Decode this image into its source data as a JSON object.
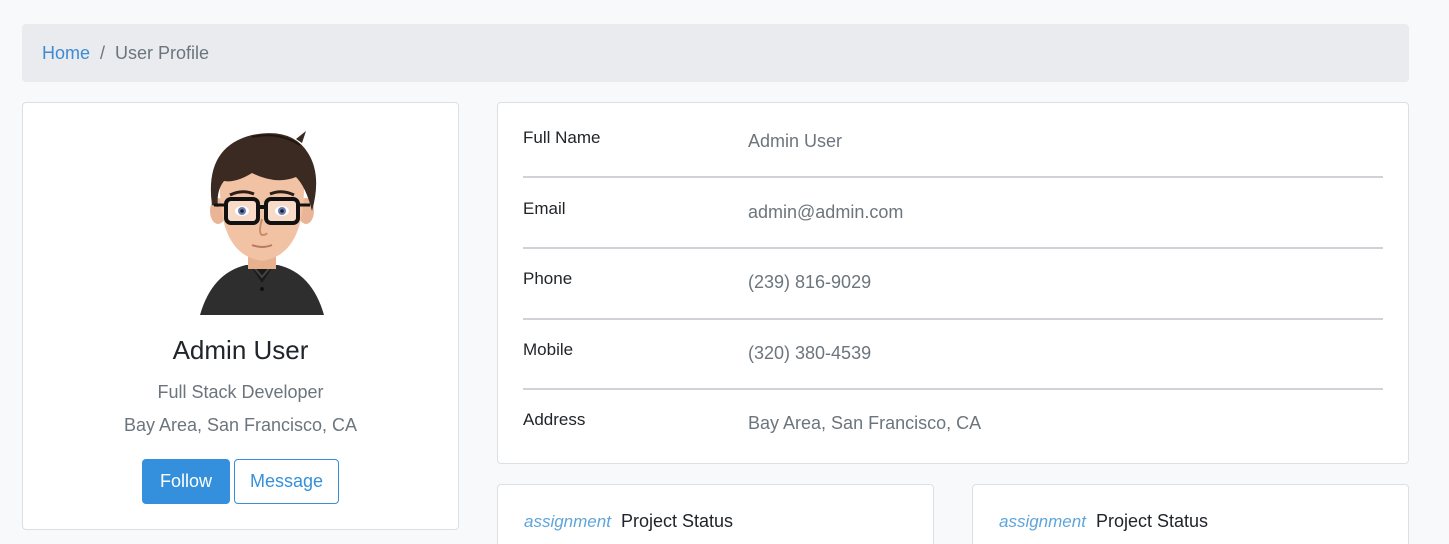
{
  "breadcrumb": {
    "home": "Home",
    "separator": "/",
    "current": "User Profile"
  },
  "profile": {
    "name": "Admin User",
    "title": "Full Stack Developer",
    "location": "Bay Area, San Francisco, CA",
    "follow_label": "Follow",
    "message_label": "Message"
  },
  "details": [
    {
      "label": "Full Name",
      "value": "Admin User"
    },
    {
      "label": "Email",
      "value": "admin@admin.com"
    },
    {
      "label": "Phone",
      "value": "(239) 816-9029"
    },
    {
      "label": "Mobile",
      "value": "(320) 380-4539"
    },
    {
      "label": "Address",
      "value": "Bay Area, San Francisco, CA"
    }
  ],
  "status_cards": [
    {
      "icon": "assignment",
      "title": "Project Status"
    },
    {
      "icon": "assignment",
      "title": "Project Status"
    }
  ],
  "colors": {
    "accent": "#3490dc",
    "link": "#3d8bd4",
    "muted": "#6c757d"
  }
}
